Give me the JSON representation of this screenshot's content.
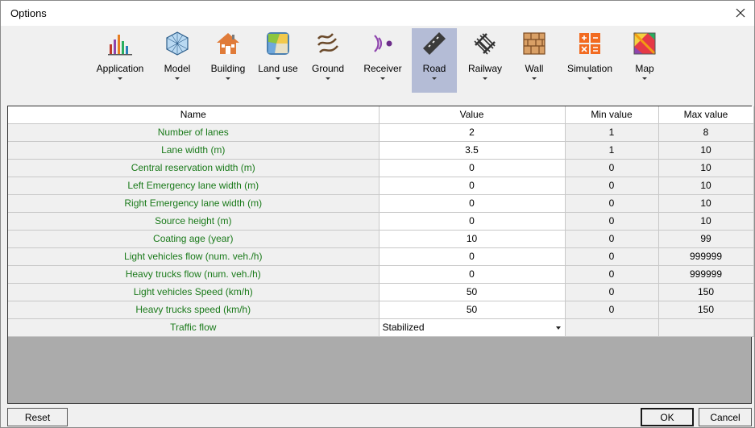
{
  "window": {
    "title": "Options"
  },
  "toolbar": {
    "items": [
      {
        "label": "Application"
      },
      {
        "label": "Model"
      },
      {
        "label": "Building"
      },
      {
        "label": "Land use"
      },
      {
        "label": "Ground"
      },
      {
        "label": "Receiver"
      },
      {
        "label": "Road"
      },
      {
        "label": "Railway"
      },
      {
        "label": "Wall"
      },
      {
        "label": "Simulation"
      },
      {
        "label": "Map"
      }
    ],
    "active": "Road"
  },
  "table": {
    "headers": {
      "name": "Name",
      "value": "Value",
      "min": "Min value",
      "max": "Max value"
    },
    "rows": [
      {
        "name": "Number of lanes",
        "value": "2",
        "min": "1",
        "max": "8"
      },
      {
        "name": "Lane width (m)",
        "value": "3.5",
        "min": "1",
        "max": "10"
      },
      {
        "name": "Central reservation width (m)",
        "value": "0",
        "min": "0",
        "max": "10"
      },
      {
        "name": "Left Emergency lane width (m)",
        "value": "0",
        "min": "0",
        "max": "10"
      },
      {
        "name": "Right Emergency lane width (m)",
        "value": "0",
        "min": "0",
        "max": "10"
      },
      {
        "name": "Source height (m)",
        "value": "0",
        "min": "0",
        "max": "10"
      },
      {
        "name": "Coating age (year)",
        "value": "10",
        "min": "0",
        "max": "99"
      },
      {
        "name": "Light vehicles flow (num. veh./h)",
        "value": "0",
        "min": "0",
        "max": "999999"
      },
      {
        "name": "Heavy trucks flow (num. veh./h)",
        "value": "0",
        "min": "0",
        "max": "999999"
      },
      {
        "name": "Light vehicles Speed (km/h)",
        "value": "50",
        "min": "0",
        "max": "150"
      },
      {
        "name": "Heavy trucks speed (km/h)",
        "value": "50",
        "min": "0",
        "max": "150"
      },
      {
        "name": "Traffic flow",
        "value": "Stabilized",
        "min": "",
        "max": ""
      }
    ]
  },
  "buttons": {
    "reset": "Reset",
    "ok": "OK",
    "cancel": "Cancel"
  }
}
